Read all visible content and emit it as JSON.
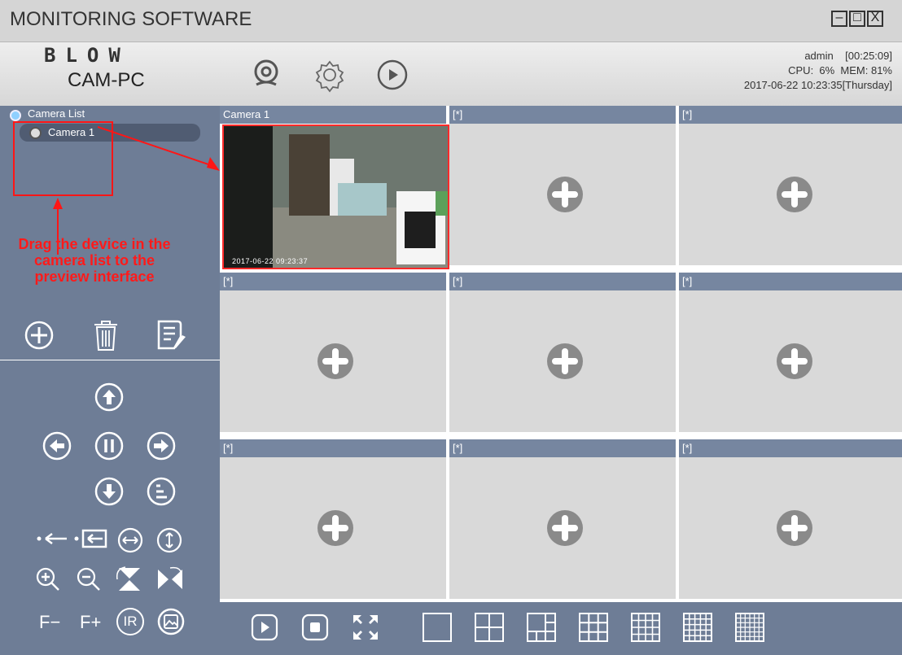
{
  "window": {
    "title": "MONITORING SOFTWARE",
    "controls": [
      "–",
      "□",
      "X"
    ]
  },
  "brand": {
    "logo_text": "BLOW",
    "name": "CAM-PC"
  },
  "toolbar_icons": [
    "camera-icon",
    "settings-gear-icon",
    "playback-icon"
  ],
  "status": {
    "line1": "admin    [00:25:09]",
    "line2": "CPU:  6%  MEM: 81%",
    "line3": "2017-06-22 10:23:35[Thursday]"
  },
  "camera_list": {
    "root_label": "Camera List",
    "items": [
      {
        "label": "Camera 1"
      }
    ]
  },
  "annotation": {
    "text": "Drag the device in the camera list to the preview interface",
    "color": "#ff1a1a"
  },
  "list_actions": [
    "add-icon",
    "delete-icon",
    "edit-icon"
  ],
  "ptz": {
    "direction_buttons": [
      "up-arrow-icon",
      "left-arrow-icon",
      "pause-icon",
      "right-arrow-icon",
      "down-arrow-icon",
      "preset-icon"
    ],
    "focus_minus": "F−",
    "focus_plus": "F+",
    "ir_label": "IR"
  },
  "preview": {
    "cells": [
      {
        "title": "Camera 1",
        "has_feed": true,
        "timestamp": "2017-06-22 09:23:37"
      },
      {
        "title": "[*]",
        "has_feed": false
      },
      {
        "title": "[*]",
        "has_feed": false
      },
      {
        "title": "[*]",
        "has_feed": false
      },
      {
        "title": "[*]",
        "has_feed": false
      },
      {
        "title": "[*]",
        "has_feed": false
      },
      {
        "title": "[*]",
        "has_feed": false
      },
      {
        "title": "[*]",
        "has_feed": false
      },
      {
        "title": "[*]",
        "has_feed": false
      }
    ]
  },
  "bottom_controls": [
    "play-icon",
    "stop-icon",
    "fullscreen-icon"
  ],
  "layouts": [
    "layout-1-icon",
    "layout-4-icon",
    "layout-6-icon",
    "layout-9-icon",
    "layout-16-icon",
    "layout-25-icon",
    "layout-36-icon"
  ],
  "colors": {
    "panel": "#6e7d96",
    "header": "#7686a0",
    "empty_cell": "#d9d9d9",
    "accent_red": "#ff2a2a"
  }
}
